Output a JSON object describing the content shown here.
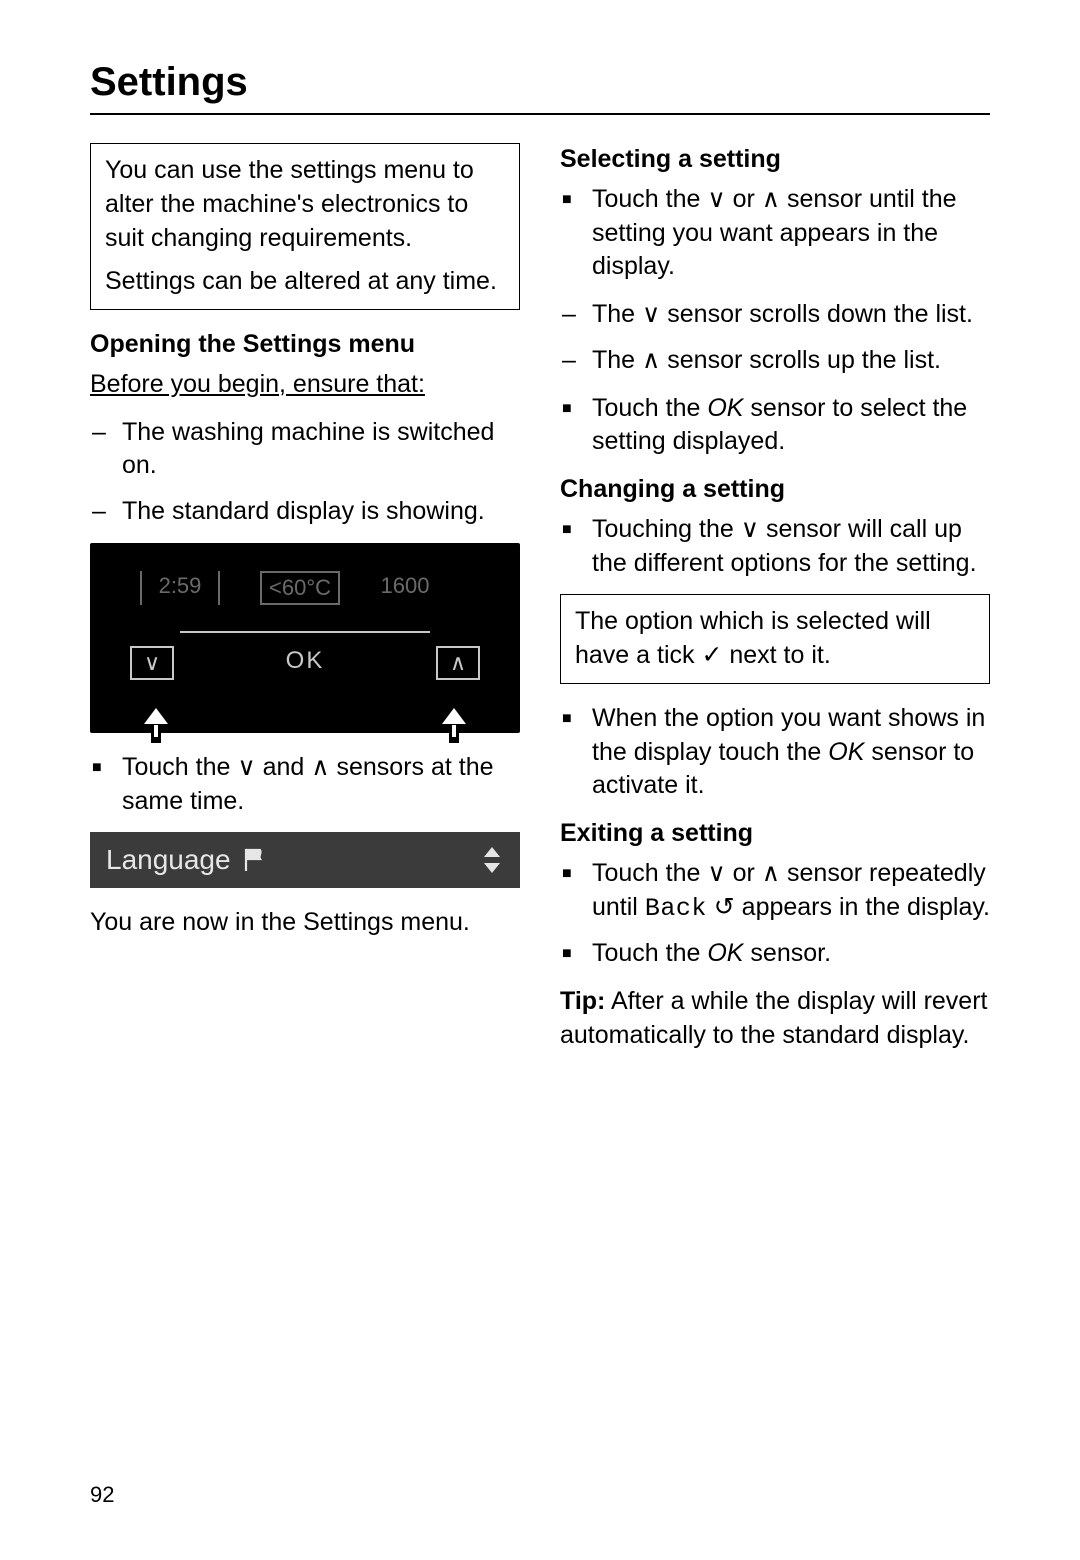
{
  "page_title": "Settings",
  "page_number": "92",
  "left": {
    "intro_box": {
      "p1": "You can use the settings menu to alter the machine's electronics to suit changing requirements.",
      "p2": "Settings can be altered at any time."
    },
    "opening_h": "Opening the Settings menu",
    "before": "Before you begin, ensure that:",
    "before_items": [
      "The washing machine is switched on.",
      "The standard display is showing."
    ],
    "display": {
      "time": "2:59",
      "temp": "60°C",
      "spin": "1600",
      "down": "∨",
      "ok": "OK",
      "up": "∧"
    },
    "touch_both": "Touch the ∨ and ∧ sensors at the same time.",
    "lang_bar_text": "Language",
    "now_in": "You are now in the Settings menu."
  },
  "right": {
    "selecting_h": "Selecting a setting",
    "sel_bullet1": "Touch the ∨ or ∧ sensor until the setting you want appears in the display.",
    "sel_dash1": "The ∨ sensor scrolls down the list.",
    "sel_dash2": "The ∧ sensor scrolls up the list.",
    "sel_bullet2_a": "Touch the ",
    "sel_bullet2_ok": "OK",
    "sel_bullet2_b": " sensor to select the setting displayed.",
    "changing_h": "Changing a setting",
    "chg_bullet1": "Touching the ∨ sensor will call up the different options for the setting.",
    "chg_box": "The option which is selected will have a tick ✓ next to it.",
    "chg_bullet2_a": "When the option you want shows in the display touch the ",
    "chg_bullet2_ok": "OK",
    "chg_bullet2_b": " sensor to activate it.",
    "exiting_h": "Exiting a setting",
    "exit_bullet1_a": "Touch the ∨ or ∧ sensor repeatedly until ",
    "exit_bullet1_back": "Back",
    "exit_bullet1_b": " ↺ appears in the display.",
    "exit_bullet2_a": "Touch the ",
    "exit_bullet2_ok": "OK",
    "exit_bullet2_b": " sensor.",
    "tip_label": "Tip:",
    "tip_body": " After a while the display will revert automatically to the standard display."
  }
}
